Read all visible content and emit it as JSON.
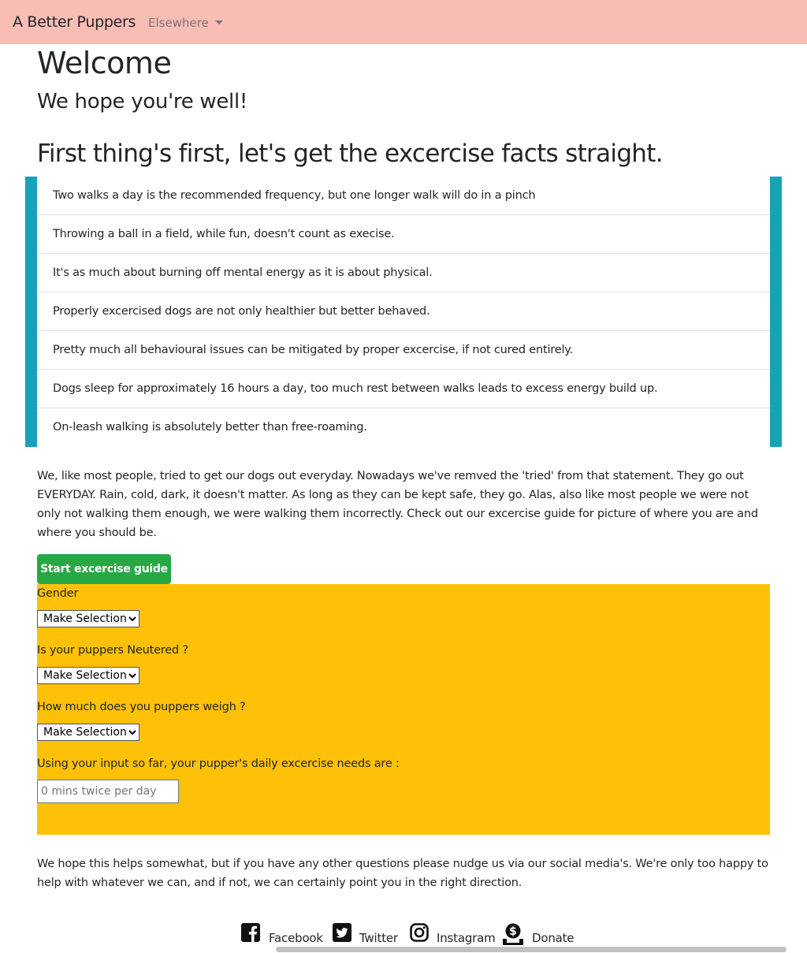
{
  "navbar": {
    "brand": "A Better Puppers",
    "dropdown_label": "Elsewhere",
    "background": "#f8bdb4"
  },
  "welcome": {
    "title": "Welcome",
    "subtitle": "We hope you're well!"
  },
  "facts_section": {
    "heading": "First thing's first, let's get the excercise facts straight.",
    "accent": "#17a2b8",
    "items": [
      "Two walks a day is the recommended frequency, but one longer walk will do in a pinch",
      "Throwing a ball in a field, while fun, doesn't count as execise.",
      "It's as much about burning off mental energy as it is about physical.",
      "Properly excercised dogs are not only healthier but better behaved.",
      "Pretty much all behavioural issues can be mitigated by proper excercise, if not cured entirely.",
      "Dogs sleep for approximately 16 hours a day, too much rest between walks leads to excess energy build up.",
      "On-leash walking is absolutely better than free-roaming."
    ]
  },
  "intro_paragraph": "We, like most people, tried to get our dogs out everyday. Nowadays we've remved the 'tried' from that statement. They go out EVERYDAY. Rain, cold, dark, it doesn't matter. As long as they can be kept safe, they go. Alas, also like most people we were not only not walking them enough, we were walking them incorrectly. Check out our excercise guide for picture of where you are and where you should be.",
  "guide": {
    "button_label": "Start excercise guide",
    "button_color": "#28a745",
    "panel_color": "#ffc107",
    "gender_label": "Gender",
    "gender_selected": "Make Selection",
    "neutered_label": "Is your puppers Neutered ?",
    "neutered_selected": "Make Selection",
    "weight_label": "How much does you puppers weigh ?",
    "weight_selected": "Make Selection",
    "result_label": "Using your input so far, your pupper's daily excercise needs are :",
    "result_placeholder": "0 mins twice per day"
  },
  "closing_paragraph": "We hope this helps somewhat, but if you have any other questions please nudge us via our social media's. We're only too happy to help with whatever we can, and if not, we can certainly point you in the right direction.",
  "social": {
    "facebook": {
      "label": "Facebook",
      "icon": "facebook-icon"
    },
    "twitter": {
      "label": "Twitter",
      "icon": "twitter-icon"
    },
    "instagram": {
      "label": "Instagram",
      "icon": "instagram-icon"
    },
    "donate": {
      "label": "Donate",
      "icon": "donate-icon"
    }
  }
}
